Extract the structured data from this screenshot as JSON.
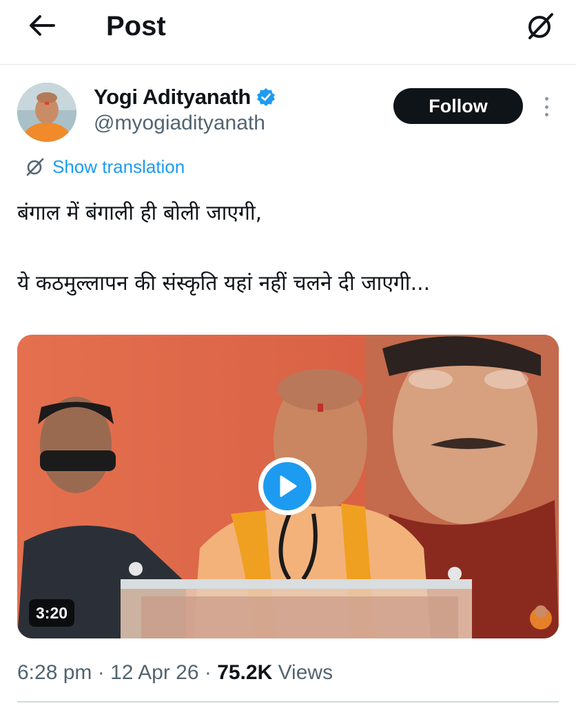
{
  "header": {
    "title": "Post",
    "back_icon": "arrow-left-icon",
    "grok_icon": "grok-icon"
  },
  "author": {
    "name": "Yogi Adityanath",
    "handle": "@myogiadityanath",
    "verified_color": "#1d9bf0",
    "follow_label": "Follow"
  },
  "translation": {
    "label": "Show translation",
    "color": "#1d9bf0"
  },
  "tweet": {
    "line1": "बंगाल में बंगाली ही बोली जाएगी,",
    "line2": "ये कठमुल्लापन की संस्कृति यहां नहीं चलने दी जाएगी..."
  },
  "media": {
    "duration": "3:20"
  },
  "meta": {
    "time": "6:28 pm",
    "separator": " · ",
    "date": "12 Apr 26",
    "views_count": "75.2K",
    "views_label": "Views"
  },
  "colors": {
    "text": "#0f1419",
    "secondary": "#536471",
    "accent": "#1d9bf0",
    "media_bg": "#d9664b"
  }
}
